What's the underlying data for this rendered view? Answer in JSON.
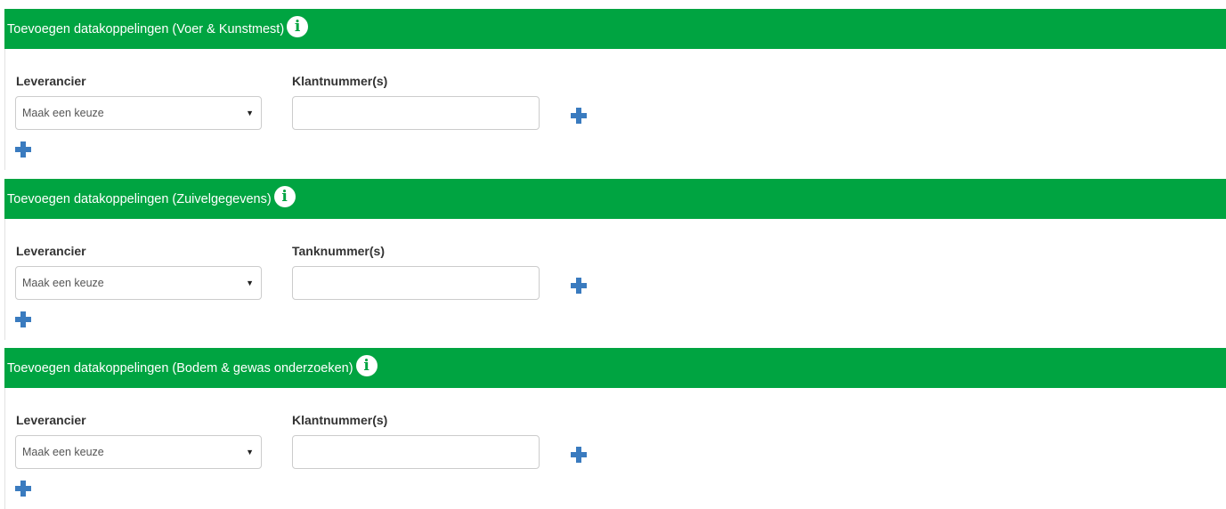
{
  "colors": {
    "header_bg": "#00a441",
    "header_text": "#ffffff",
    "plus_icon": "#3a7bbf"
  },
  "sections": [
    {
      "title": "Toevoegen datakoppelingen (Voer & Kunstmest)",
      "info_icon": "info-circle-icon",
      "supplier_label": "Leverancier",
      "supplier_select_value": "Maak een keuze",
      "number_label": "Klantnummer(s)",
      "number_value": ""
    },
    {
      "title": "Toevoegen datakoppelingen (Zuivelgegevens)",
      "info_icon": "info-circle-icon",
      "supplier_label": "Leverancier",
      "supplier_select_value": "Maak een keuze",
      "number_label": "Tanknummer(s)",
      "number_value": ""
    },
    {
      "title": "Toevoegen datakoppelingen (Bodem & gewas onderzoeken)",
      "info_icon": "info-circle-icon",
      "supplier_label": "Leverancier",
      "supplier_select_value": "Maak een keuze",
      "number_label": "Klantnummer(s)",
      "number_value": ""
    }
  ]
}
